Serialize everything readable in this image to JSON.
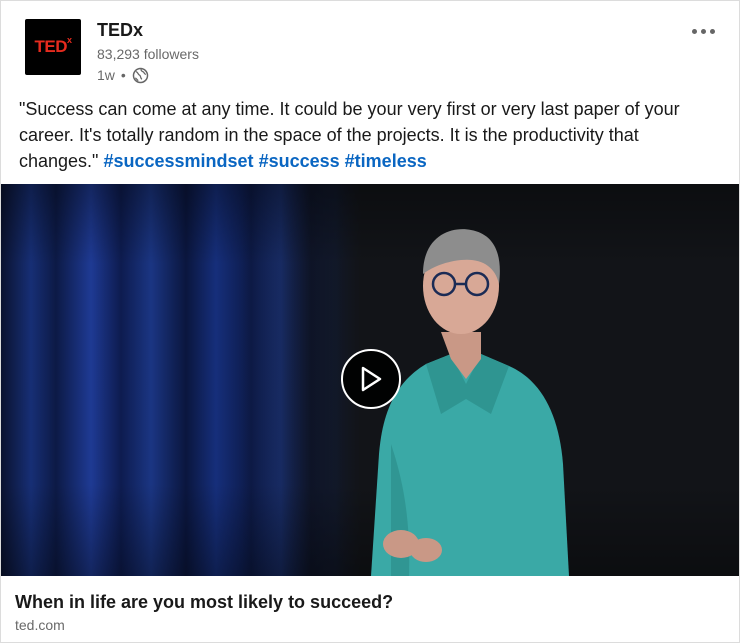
{
  "author": {
    "logo_text": "TED",
    "logo_sup": "x",
    "name": "TEDx",
    "followers": "83,293 followers",
    "time": "1w",
    "separator": "•",
    "visibility_icon": "globe-icon"
  },
  "menu": {
    "icon": "more-horizontal-icon"
  },
  "post": {
    "text": "\"Success can come at any time. It could be your very first or very last paper of your career. It's totally random in the space of the projects. It is the productivity that changes.\"",
    "hashtags": [
      "#successmindset",
      "#success",
      "#timeless"
    ]
  },
  "media": {
    "type": "video",
    "play_icon": "play-icon"
  },
  "article": {
    "title": "When in life are you most likely to succeed?",
    "source": "ted.com"
  },
  "colors": {
    "hashtag": "#0a66c2",
    "logo_red": "#e62b1e",
    "shirt": "#3fb6b2"
  }
}
